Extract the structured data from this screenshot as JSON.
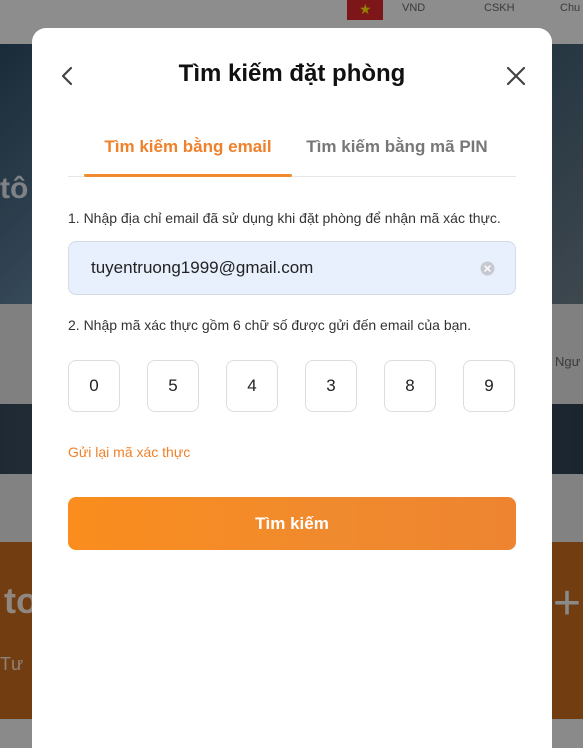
{
  "background": {
    "currency": "VND",
    "support_link": "CSKH",
    "partial_text": "Chu",
    "hero_fragment": "tô",
    "right_fragment": "Ngư",
    "promo_fragment": "to",
    "promo_sub_fragment": "Tư"
  },
  "modal": {
    "title": "Tìm kiếm đặt phòng",
    "tabs": [
      {
        "label": "Tìm kiếm bằng email",
        "active": true
      },
      {
        "label": "Tìm kiếm bằng mã PIN",
        "active": false
      }
    ],
    "step1_label": "1. Nhập địa chỉ email đã sử dụng khi đặt phòng để nhận mã xác thực.",
    "email_value": "tuyentruong1999@gmail.com",
    "step2_label": "2. Nhập mã xác thực gồm 6 chữ số được gửi đến email của bạn.",
    "otp_digits": [
      "0",
      "5",
      "4",
      "3",
      "8",
      "9"
    ],
    "resend_label": "Gửi lại mã xác thực",
    "search_button": "Tìm kiếm"
  },
  "colors": {
    "accent": "#f0802a",
    "email_field_bg": "#e8f0fd",
    "overlay": "rgba(0,0,0,0.42)"
  },
  "icons": {
    "back": "chevron-left-icon",
    "close": "close-icon",
    "clear": "clear-circle-icon"
  }
}
